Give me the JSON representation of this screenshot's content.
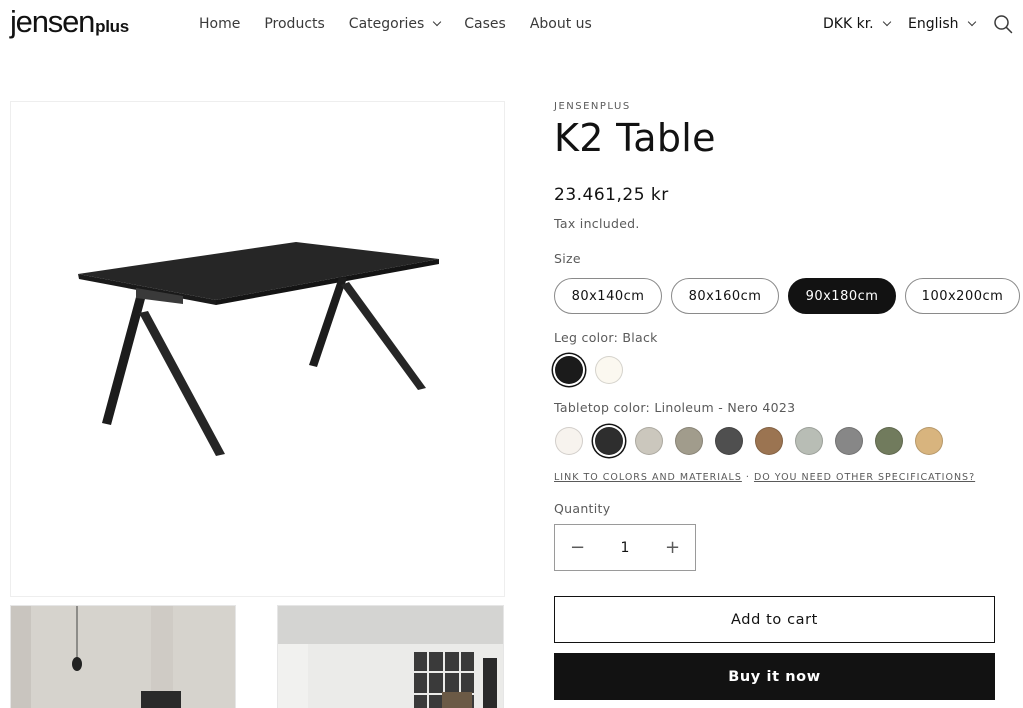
{
  "header": {
    "logo_main": "JENSEN",
    "logo_sub": "plus",
    "nav": [
      {
        "label": "Home"
      },
      {
        "label": "Products"
      },
      {
        "label": "Categories"
      },
      {
        "label": "Cases"
      },
      {
        "label": "About us"
      }
    ],
    "currency": "DKK kr.",
    "language": "English",
    "icons": {
      "search": "search-icon",
      "dropdown": "chevron-down-icon"
    }
  },
  "product": {
    "vendor": "JENSENPLUS",
    "title": "K2 Table",
    "price": "23.461,25 kr",
    "tax_note": "Tax included.",
    "size": {
      "label": "Size",
      "options": [
        "80x140cm",
        "80x160cm",
        "90x180cm",
        "100x200cm"
      ],
      "selected": "90x180cm"
    },
    "leg_color": {
      "label": "Leg color: Black",
      "swatches": [
        "#1b1b1b",
        "#fbf8f0"
      ],
      "selected_index": 0
    },
    "tabletop_color": {
      "label": "Tabletop color: Linoleum - Nero 4023",
      "swatches": [
        "#f7f3ee",
        "#2e2e2e",
        "#cbc7bd",
        "#a19c8c",
        "#4f4f4f",
        "#9b7451",
        "#b8bdb5",
        "#878787",
        "#717b5d",
        "#d8b47e"
      ],
      "selected_index": 1
    },
    "links": {
      "colors": "LINK TO COLORS AND MATERIALS",
      "separator": "·",
      "specs": "DO YOU NEED OTHER SPECIFICATIONS?"
    },
    "quantity": {
      "label": "Quantity",
      "value": "1",
      "minus": "−",
      "plus": "+"
    },
    "add_to_cart": "Add to cart",
    "buy_now": "Buy it now"
  }
}
